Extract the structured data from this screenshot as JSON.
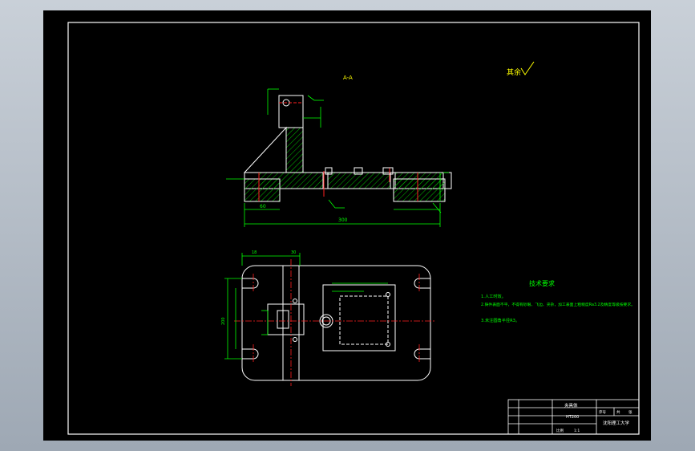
{
  "drawing": {
    "section_label": "A-A",
    "roughness_note": "其余",
    "tech_requirements": {
      "title": "技术要求",
      "lines": [
        "1.人工时效。",
        "2.铸件表面不平，不得有砂眼、飞边、夹杂，加工表面上粗糙度Ra3.2及精度等级按要求。",
        "3.未注圆角半径R3。"
      ]
    },
    "title_block": {
      "part_name": "夹具体",
      "material": "HT200",
      "school": "沈阳理工大学",
      "cells": [
        "序号",
        "比例",
        "1:1",
        "共",
        "张"
      ]
    },
    "dims": {
      "overall_length": "300",
      "base_width": "200",
      "left_step": "60",
      "top_a": "18",
      "top_b": "30"
    }
  },
  "colors": {
    "outline": "#ffffff",
    "dimension": "#00ff00",
    "hatch": "#00ff00",
    "center": "#ff2020",
    "text_yellow": "#ffff00"
  }
}
